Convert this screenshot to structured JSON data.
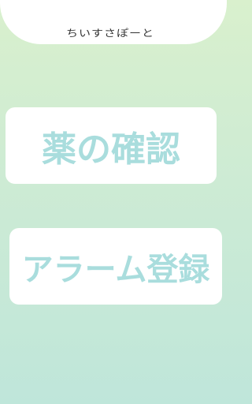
{
  "header": {
    "title": "ちいすさぽーと"
  },
  "menu": {
    "check_label": "薬の確認",
    "alarm_label": "アラーム登録"
  },
  "colors": {
    "background_top": "#d9f0cd",
    "background_bottom": "#bfe6da",
    "button_text": "#a9dddd",
    "card": "#ffffff"
  }
}
